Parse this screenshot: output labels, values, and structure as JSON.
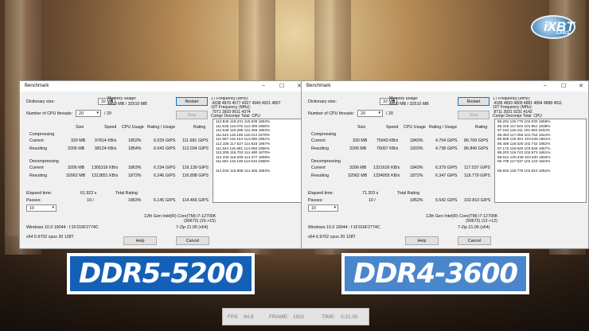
{
  "logo": {
    "text": "iXBT",
    "small": "LABS"
  },
  "windows": [
    {
      "title": "Benchmark",
      "dict_label": "Dictionary size:",
      "dict_value": "32 MB",
      "threads_label": "Number of CPU threads:",
      "threads_value": "20",
      "threads_max": "/ 20",
      "mem_label": "Memory usage:",
      "mem_value": "4450 MB / 32510 MB",
      "restart": "Restart",
      "stop": "Stop",
      "headers": [
        "Size",
        "Speed",
        "CPU Usage",
        "Rating / Usage",
        "Rating"
      ],
      "compressing": "Compressing",
      "decompressing": "Decompressing",
      "current": "Current",
      "resulting": "Resulting",
      "comp_current": [
        "320 MB",
        "97814 KB/s",
        "1852%",
        "6.029 GIPS",
        "111.681 GIPS"
      ],
      "comp_result": [
        "3206 MB",
        "98124 KB/s",
        "1854%",
        "6.043 GIPS",
        "112.034 GIPS"
      ],
      "decomp_current": [
        "3206 MB",
        "1305316 KB/s",
        "1863%",
        "6.234 GIPS",
        "116.139 GIPS"
      ],
      "decomp_result": [
        "32062 MB",
        "1313851 KB/s",
        "1872%",
        "6.246 GIPS",
        "116.898 GIPS"
      ],
      "elapsed_label": "Elapsed time:",
      "elapsed_value": "61.922 s",
      "passes_label": "Passes:",
      "passes_value": "10 /",
      "passes_select": "10",
      "total_label": "Total Rating",
      "total_usage": "1863%",
      "total_ru": "6.145 GIPS",
      "total_rating": "114.466 GIPS",
      "cpu_name": "12th Gen Intel(R) Core(TM) i7-12700K",
      "cpu_id": "(90672) (15->15)",
      "os": "Windows 10.0 19044 : f:1F316F2774C",
      "zip": "7-Zip 21.06 (x64)",
      "arch": "x64 6.9702 cpus 20 128T",
      "help": "Help",
      "cancel": "Cancel",
      "freq_header": "1T Frequency (MHz):\n 4338 4876 4577 4927 4940 4921 4897\n10T Frequency (MHz):\n 7971 3603 9611 4374\nCompr Decompr Total  CPU",
      "log_rows": [
        "112.845  119.231  115.538  1853%",
        "111.535  115.075  113.309  1855%",
        "112.648  116.285  114.466  1854%",
        "111.542  118.105  115.013  1878%",
        "111.957  116.154  114.056  1861%",
        "112.105  117.527  114.816  1867%",
        "111.944  116.591  114.068  1855%",
        "112.208  116.753  114.480  1870%",
        "112.345  116.209  114.277  1858%",
        "111.681  116.139  113.910  1858%",
        "",
        "112.034  116.898  114.466  1863%"
      ]
    },
    {
      "title": "Benchmark",
      "dict_label": "Dictionary size:",
      "dict_value": "32 MB",
      "threads_label": "Number of CPU threads:",
      "threads_value": "20",
      "threads_max": "/ 20",
      "mem_label": "Memory usage:",
      "mem_value": "4450 MB / 32510 MB",
      "restart": "Restart",
      "stop": "Stop",
      "headers": [
        "Size",
        "Speed",
        "CPU Usage",
        "Rating / Usage",
        "Rating"
      ],
      "compressing": "Compressing",
      "decompressing": "Decompressing",
      "current": "Current",
      "resulting": "Resulting",
      "comp_current": [
        "320 MB",
        "75943 KB/s",
        "1843%",
        "4.704 GIPS",
        "86.709 GIPS"
      ],
      "comp_result": [
        "3206 MB",
        "76057 KB/s",
        "1833%",
        "4.738 GIPS",
        "86.840 GIPS"
      ],
      "decomp_current": [
        "3206 MB",
        "1321626 KB/s",
        "1843%",
        "6.379 GIPS",
        "117.537 GIPS"
      ],
      "decomp_result": [
        "32062 MB",
        "1334955 KB/s",
        "1872%",
        "6.347 GIPS",
        "118.779 GIPS"
      ],
      "elapsed_label": "Elapsed time:",
      "elapsed_value": "71.203 s",
      "passes_label": "Passes:",
      "passes_value": "10 /",
      "passes_select": "10",
      "total_label": "Total Rating",
      "total_usage": "1852%",
      "total_ru": "5.542 GIPS",
      "total_rating": "102.810 GIPS",
      "cpu_name": "12th Gen Intel(R) Core(TM) i7-12700K",
      "cpu_id": "(90672) (12->12)",
      "os": "Windows 10.0 19044 : f:1F316F2774C",
      "zip": "7-Zip 21.06 (x64)",
      "arch": "x64 6.9702 cpus 20 128T",
      "help": "Help",
      "cancel": "Cancel",
      "freq_header": "1T Frequency (MHz):\n 4186 4893 4809 4881 4894 4898 4911\n10T Frequency (MHz):\n 8711 3931 9231 4142\nCompr Decompr Total  CPU",
      "log_rows": [
        "86.291  119.776  104.030  1859%",
        "86.318  117.924  101.951  1838%",
        "87.194  116.411  101.802  1833%",
        "86.453  117.056  101.754  1844%",
        "86.908  120.301  103.645  1861%",
        "86.458  119.025  102.742  1852%",
        "87.172  119.920  103.546  1867%",
        "86.203  119.743  102.973  1861%",
        "86.612  120.448  103.530  1864%",
        "86.709  117.537  102.123  1844%",
        "",
        "86.840  118.779  102.810  1852%"
      ]
    }
  ],
  "badges": {
    "left": "DDR5-5200",
    "right": "DDR4-3600"
  },
  "fps_bar": {
    "fps_label": "FPS",
    "fps_value": "94.8",
    "frame_label": "FRAME:",
    "frame_value": "1931",
    "time_label": "TIME:",
    "time_value": "0:21.00"
  }
}
